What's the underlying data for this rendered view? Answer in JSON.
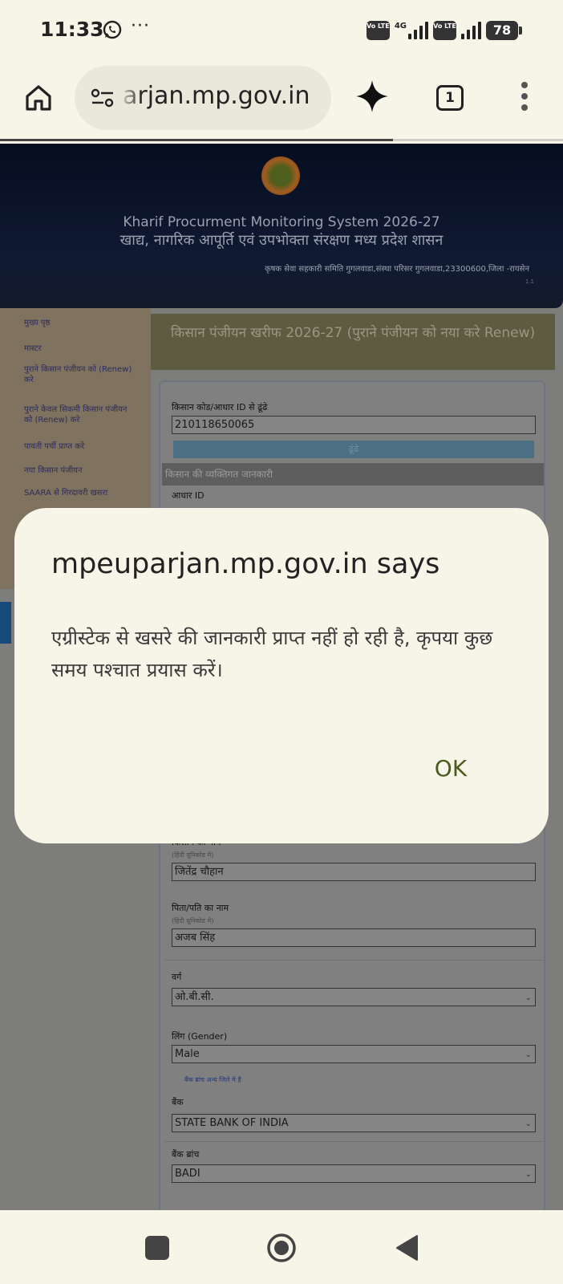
{
  "status_bar": {
    "time": "11:33",
    "more": "···",
    "volte": "Vo LTE",
    "network": "4G",
    "battery": "78"
  },
  "browser": {
    "url": "mpeuparjan.mp.gov.in",
    "url_visible": "arjan.mp.gov.in",
    "tab_count": "1"
  },
  "banner": {
    "title": "Kharif Procurment Monitoring System 2026-27",
    "subtitle": "खाद्य, नागरिक आपूर्ति एवं उपभोक्ता संरक्षण मध्य प्रदेश शासन",
    "address": "कृषक सेवा सहकारी समिति गुगलवाडा,संस्था परिसर गुगलवाडा,23300600,जिला -रायसेन",
    "tiny": "1.1"
  },
  "sidebar": {
    "items": [
      "मुख्य पृष्ठ",
      "मास्टर",
      "पुराने किसान पंजीयन को (Renew) करे",
      "पुराने केवल सिकमी किसान पंजीयन को (Renew) करे",
      "पावती पर्ची प्राप्त करे",
      "नया किसान पंजीयन",
      "SAARA से गिरदावरी खसरा"
    ]
  },
  "form": {
    "heading": "किसान पंजीयन खरीफ 2026-27 (पुराने पंजीयन को नया करे Renew)",
    "search_label": "किसान कोड/आधार ID से ढूंढे",
    "search_value": "210118650065",
    "search_button": "ढूंढे",
    "section_title": "किसान की व्यक्तिगत जानकारी",
    "aadhar_label": "आधार ID",
    "name_label": "किसान का नाम",
    "name_hint": "(हिंदी यूनिकोड मे)",
    "name_value": "जितेंद्र चौहान",
    "father_label": "पिता/पति का नाम",
    "father_hint": "(हिंदी यूनिकोड मे)",
    "father_value": "अजब सिंह",
    "category_label": "वर्ग",
    "category_value": "ओ.बी.सी.",
    "gender_label": "लिंग (Gender)",
    "gender_value": "Male",
    "branch_other_link": "बैंक ब्रांच अन्य जिले मे है",
    "bank_label": "बैंक",
    "bank_value": "STATE BANK OF INDIA",
    "branch_label": "बैंक ब्रांच",
    "branch_value": "BADI"
  },
  "dialog": {
    "title": "mpeuparjan.mp.gov.in says",
    "message": "एग्रीस्टेक से खसरे की जानकारी प्राप्त नहीं हो रही है, कृपया कुछ समय पश्चात प्रयास करें।",
    "ok": "OK"
  },
  "colors": {
    "dialog_bg": "#f7f5e8",
    "ok_text": "#4b5a1e",
    "banner_bg": "#0b1428",
    "scrim": "#7d7d7b"
  },
  "icons": [
    "whatsapp-icon",
    "home-icon",
    "site-settings-icon",
    "gemini-icon",
    "tabs-icon",
    "menu-icon",
    "nav-recents-icon",
    "nav-home-icon",
    "nav-back-icon"
  ]
}
